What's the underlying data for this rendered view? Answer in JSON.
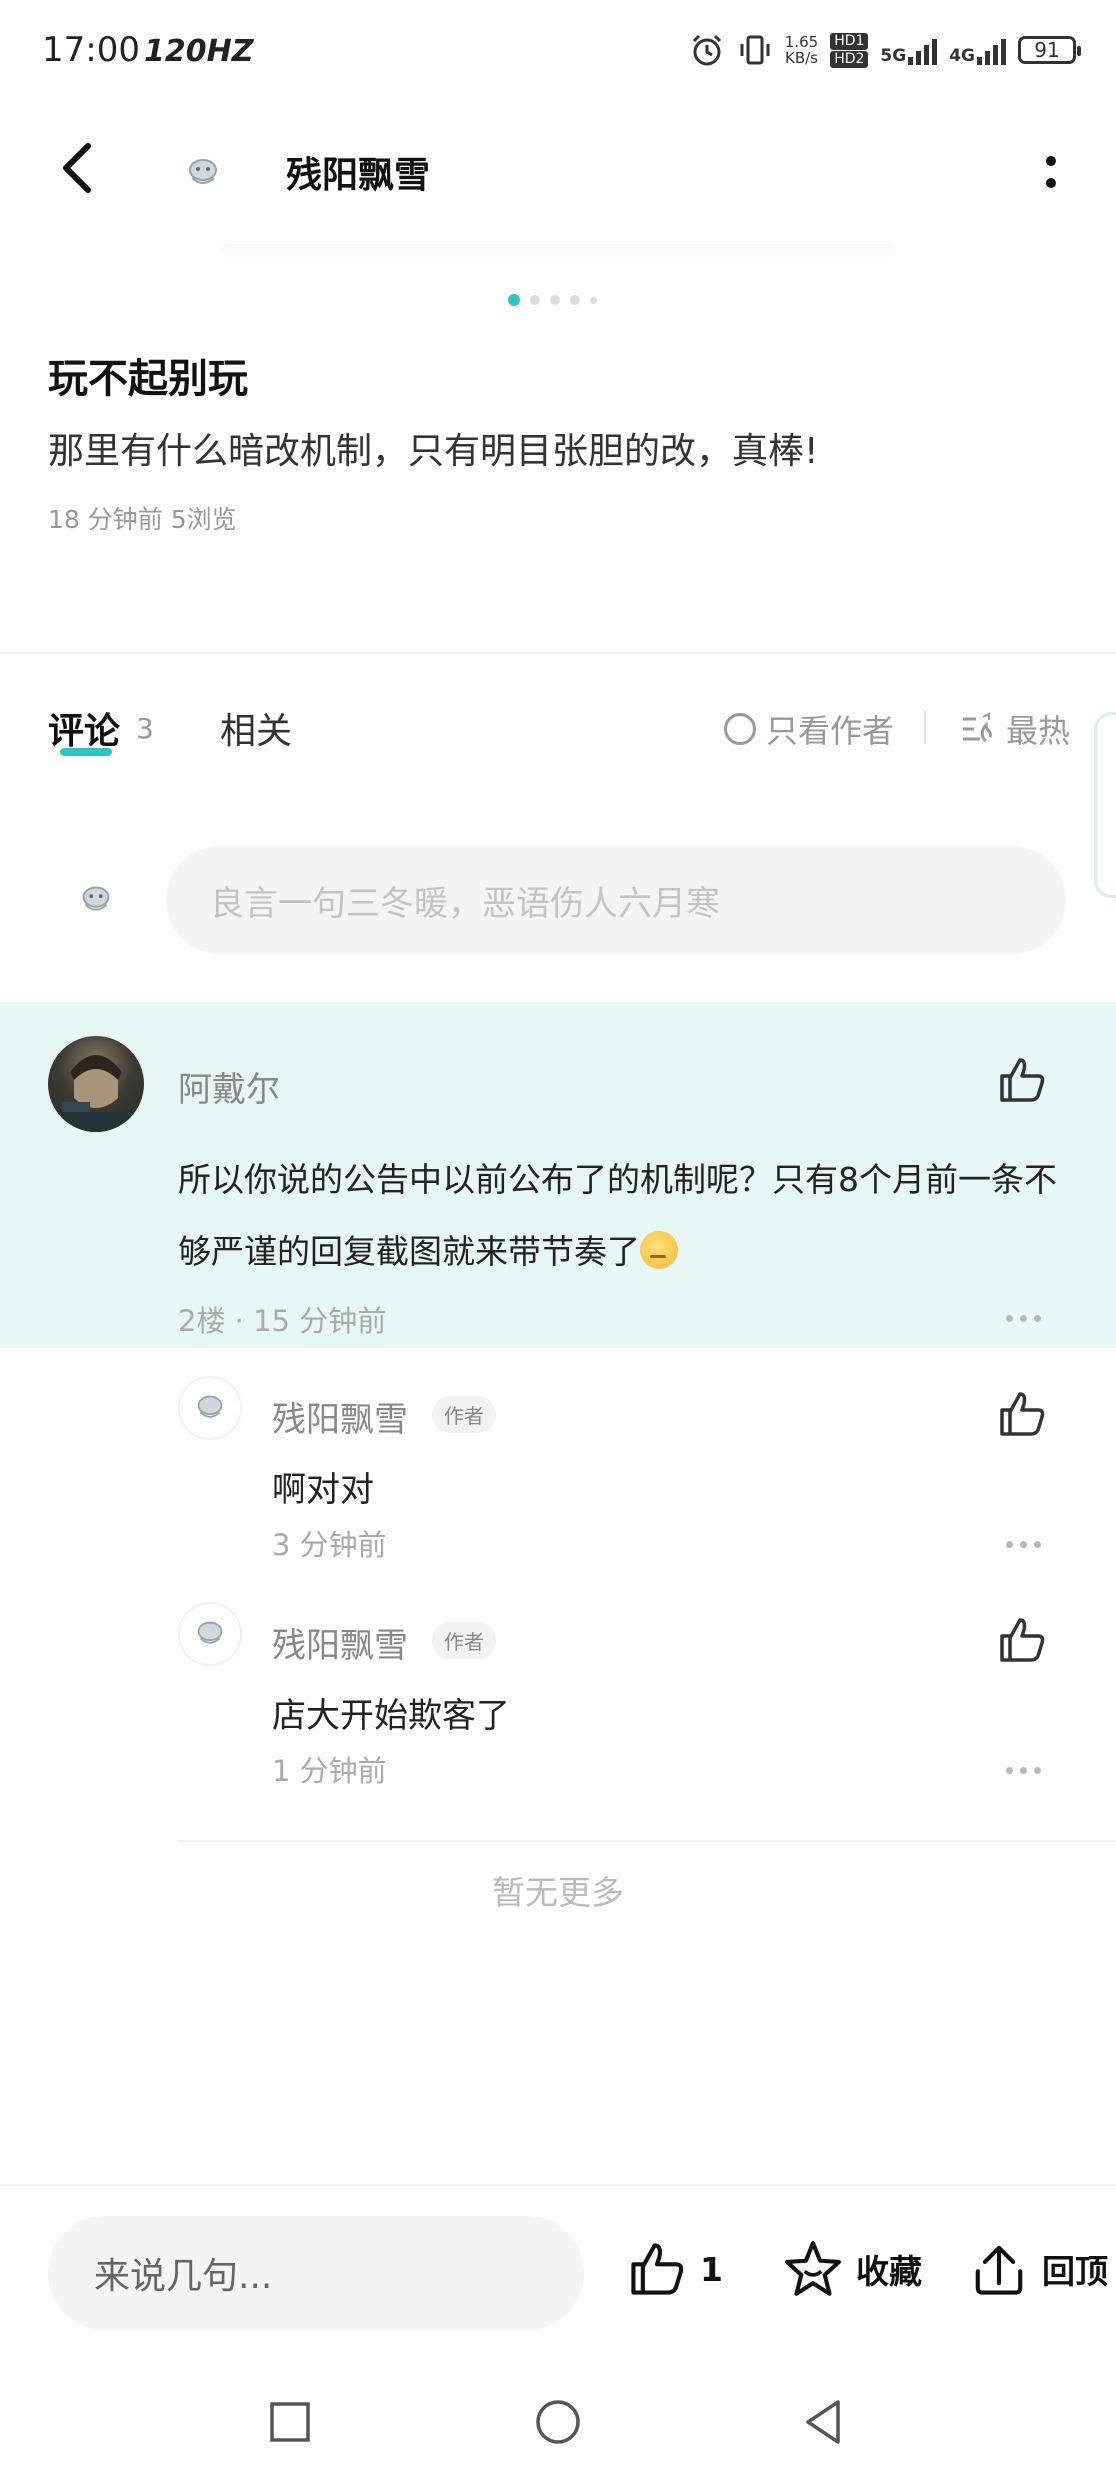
{
  "status_bar": {
    "time": "17:00",
    "refresh_rate": "120HZ",
    "net_speed_value": "1.65",
    "net_speed_unit": "KB/s",
    "hd1": "HD1",
    "hd2": "HD2",
    "net_5g": "5G",
    "net_4g": "4G",
    "battery": "91"
  },
  "header": {
    "username": "残阳飘雪"
  },
  "post": {
    "title": "玩不起别玩",
    "body": "那里有什么暗改机制，只有明目张胆的改，真棒!",
    "meta": "18 分钟前  5浏览"
  },
  "tabs": {
    "comments_label": "评论",
    "comments_count": "3",
    "related_label": "相关",
    "author_only_label": "只看作者",
    "sort_label": "最热"
  },
  "comment_input": {
    "placeholder": "良言一句三冬暖，恶语伤人六月寒"
  },
  "comment": {
    "username": "阿戴尔",
    "text": "所以你说的公告中以前公布了的机制呢？只有8个月前一条不够严谨的回复截图就来带节奏了",
    "meta": "2楼 · 15 分钟前"
  },
  "replies": [
    {
      "username": "残阳飘雪",
      "tag": "作者",
      "text": "啊对对",
      "time": "3 分钟前"
    },
    {
      "username": "残阳飘雪",
      "tag": "作者",
      "text": "店大开始欺客了",
      "time": "1 分钟前"
    }
  ],
  "footer_note": "暂无更多",
  "bottom_bar": {
    "input_placeholder": "来说几句...",
    "like_count": "1",
    "favorite_label": "收藏",
    "bump_label": "回顶"
  },
  "colors": {
    "accent": "#2fc6c0",
    "highlight_bg": "#e6f7f6",
    "input_bg": "#f3f4f5"
  }
}
